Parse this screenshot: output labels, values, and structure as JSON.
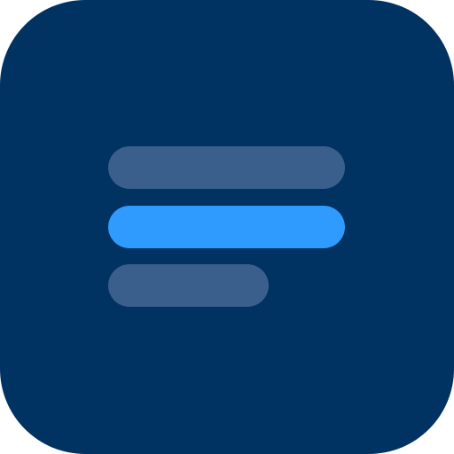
{
  "icon": {
    "name": "menu-lines-icon",
    "background_color": "#003262",
    "bars": [
      {
        "name": "top-bar",
        "color": "#3a5f8c"
      },
      {
        "name": "middle-bar",
        "color": "#2f9bff"
      },
      {
        "name": "bottom-bar",
        "color": "#3a5f8c"
      }
    ]
  }
}
